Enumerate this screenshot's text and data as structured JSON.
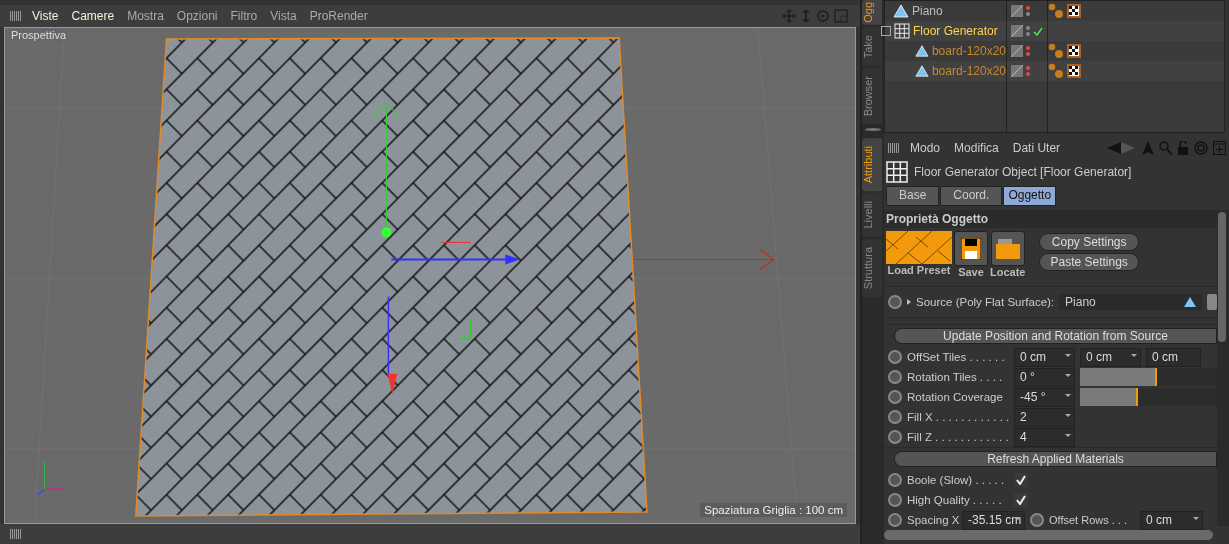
{
  "viewport": {
    "menu": [
      {
        "label": "Viste",
        "highlighted": true
      },
      {
        "label": "Camere",
        "highlighted": true
      },
      {
        "label": "Mostra",
        "highlighted": false
      },
      {
        "label": "Opzioni",
        "highlighted": false
      },
      {
        "label": "Filtro",
        "highlighted": false
      },
      {
        "label": "Vista",
        "highlighted": false
      },
      {
        "label": "ProRender",
        "highlighted": false
      }
    ],
    "view_label": "Prospettiva",
    "grid_label": "Spaziatura Griglia : 100 cm"
  },
  "side_tabs_top": [
    {
      "label": "Ogg",
      "selected": true
    },
    {
      "label": "Take",
      "selected": false
    },
    {
      "label": "Browser",
      "selected": false
    }
  ],
  "objects": [
    {
      "name": "Piano",
      "selected": false,
      "checkmark": false,
      "material_tag": true
    },
    {
      "name": "Floor Generator",
      "selected": true,
      "checkmark": true,
      "material_tag": false,
      "children": [
        {
          "name": "board-120x20",
          "selected": false,
          "checkmark": false,
          "material_tag": true
        },
        {
          "name": "board-120x20",
          "selected": false,
          "checkmark": false,
          "material_tag": true
        }
      ]
    }
  ],
  "side_tabs_bottom": [
    {
      "label": "Attributi",
      "selected": true
    },
    {
      "label": "Livelli",
      "selected": false
    },
    {
      "label": "Struttura",
      "selected": false
    }
  ],
  "attributes": {
    "menu": [
      "Modo",
      "Modifica",
      "Dati Uter"
    ],
    "title": "Floor Generator Object [Floor Generator]",
    "tabs": [
      {
        "label": "Base",
        "selected": false
      },
      {
        "label": "Coord.",
        "selected": false
      },
      {
        "label": "Oggetto",
        "selected": true
      }
    ],
    "section": "Proprietà Oggetto",
    "preset_buttons": [
      {
        "label": "Load Preset",
        "kind": "preset"
      },
      {
        "label": "Save",
        "kind": "save"
      },
      {
        "label": "Locate",
        "kind": "folder"
      }
    ],
    "settings_buttons": [
      "Copy Settings",
      "Paste Settings"
    ],
    "source": {
      "label": "Source (Poly Flat Surface):",
      "value": "Piano"
    },
    "parameters": [
      {
        "kind": "button",
        "label": "Update Position and Rotation from Source"
      },
      {
        "kind": "vector",
        "label": "OffSet Tiles . . . . . .",
        "values": [
          "0 cm",
          "0 cm",
          "0 cm"
        ]
      },
      {
        "kind": "slider",
        "label": "Rotation Tiles . . . .",
        "value": "0 °",
        "level": 0.55
      },
      {
        "kind": "slider",
        "label": "Rotation Coverage",
        "value": "-45 °",
        "level": 0.41
      },
      {
        "kind": "number",
        "label": "Fill X . . . . . . . . . . . .",
        "value": "2"
      },
      {
        "kind": "number",
        "label": "Fill Z . . . . . . . . . . . .",
        "value": "4"
      },
      {
        "kind": "button",
        "label": "Refresh Applied Materials"
      },
      {
        "kind": "checkbox",
        "label": "Boole (Slow) . . . . .",
        "checked": true
      },
      {
        "kind": "checkbox",
        "label": "High Quality . . . . .",
        "checked": true
      },
      {
        "kind": "pair",
        "label": "Spacing X",
        "value": "-35.15 cm",
        "label2": "Offset Rows . . .",
        "value2": "0 cm"
      }
    ]
  }
}
